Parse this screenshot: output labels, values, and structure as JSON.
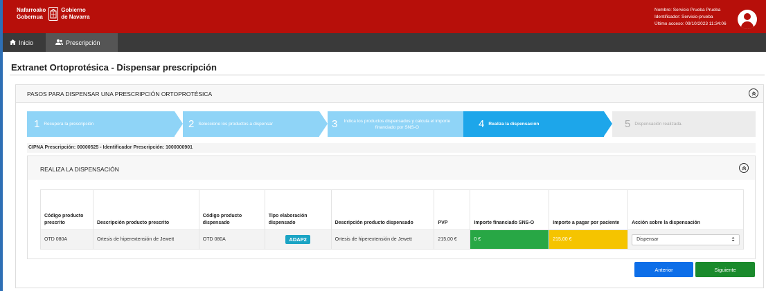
{
  "header": {
    "logo_line1_left": "Nafarroako",
    "logo_line2_left": "Gobernua",
    "logo_line1_right": "Gobierno",
    "logo_line2_right": "de Navarra",
    "user_name": "Nombre: Servicio Prueba Prueba",
    "user_id": "Identificador: Servicio-prueba",
    "last_access": "Último acceso: 09/10/2023 11:34:06"
  },
  "nav": {
    "home": "Inicio",
    "prescription": "Prescripción"
  },
  "page": {
    "title": "Extranet Ortoprotésica - Dispensar prescripción"
  },
  "panel": {
    "title": "PASOS PARA DISPENSAR UNA PRESCRIPCIÓN ORTOPROTÉSICA"
  },
  "steps": [
    {
      "num": "1",
      "label": "Recupera la prescripción",
      "state": "done"
    },
    {
      "num": "2",
      "label": "Seleccione los productos a dispensar",
      "state": "done"
    },
    {
      "num": "3",
      "label": "Indica los productos dispensados y calcula el importe financiado por SNS-O",
      "state": "done"
    },
    {
      "num": "4",
      "label": "Realiza la dispensación",
      "state": "active"
    },
    {
      "num": "5",
      "label": "Dispensación realizada.",
      "state": "todo"
    }
  ],
  "cipna": "CIPNA Prescripción: 00000525 - Identificador Prescripción: 1000000901",
  "dispense": {
    "title": "REALIZA LA DISPENSACIÓN",
    "columns": [
      "Código producto prescrito",
      "Descripción producto prescrito",
      "Código producto dispensado",
      "Tipo elaboración dispensado",
      "Descripción producto dispensado",
      "PVP",
      "Importe financiado SNS-O",
      "Importe a pagar por paciente",
      "Acción sobre la dispensación"
    ],
    "row": {
      "code_prescribed": "OTD 080A",
      "desc_prescribed": "Ortesis de hiperextensión de Jewett",
      "code_dispensed": "OTD 080A",
      "type": "ADAP2",
      "desc_dispensed": "Ortesis de hiperextensión de Jewett",
      "pvp": "215,00 €",
      "financed": "0 €",
      "patient_pays": "215,00 €",
      "action": "Dispensar"
    }
  },
  "buttons": {
    "previous": "Anterior",
    "next": "Siguiente"
  },
  "colors": {
    "header": "#b70f0a",
    "step_done": "#8fd4f7",
    "step_active": "#1da6ea",
    "financed": "#28a745",
    "patient": "#f5c400",
    "prev_button": "#0d6ee8",
    "next_button": "#1a8a2c"
  },
  "icons": [
    "home-icon",
    "users-icon",
    "user-avatar-icon",
    "collapse-up-icon",
    "select-caret-icon"
  ]
}
